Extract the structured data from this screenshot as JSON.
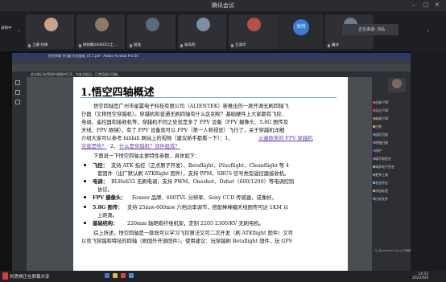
{
  "meeting": {
    "title": "腾讯会议",
    "local_user": "录制中"
  },
  "participants": [
    {
      "name": "土豪·孙妍",
      "avatar_color": "#c9a28a"
    },
    {
      "name": "杨帅鹏2006051土...",
      "avatar_color": "#8b7a66"
    },
    {
      "name": "鼓渔",
      "avatar_color": "#5a6b7a"
    },
    {
      "name": "骑岛院",
      "avatar_color": "#7a8fa3"
    },
    {
      "name": "王滨玲",
      "avatar_color": "#b8504a"
    },
    {
      "name": "冀冰",
      "avatar_color": "#6a7c8e"
    }
  ],
  "presenter": {
    "avatar_text": "洪玲",
    "speaking": "正在讲话: 刘弘"
  },
  "pdf": {
    "window_title": "悟空四轴飞行器-开发指南_V1.1.pdf - Adobe Acrobat Pro DC",
    "notice": "此文档已在受保护视图中打开。为安全起见，已禁用部分功能。",
    "heading": "1.悟空四轴概述",
    "paragraphs": [
      "悟空四轴是广州市星翼电子科技有限公司（ALIENTEK）新推出的一款开源无刷四轴飞",
      "行器（又称悟空穿越机）。穿越机和普通无刷四轴有什么区别呢？基础硬件上大家都有飞控、",
      "电调、遥控器和接收机等，穿越机不同之处就是多了 FPV 设备（FPV 摄像头、5.8G 图传及",
      "天线、FPV 眼镜），有了 FPV 设备就可以 FPV（第一人称视觉）飞行了，关于穿越机详细",
      "介绍大家可以参考 bilibili 网站上的视频（建议新手都看一下）：1、",
      "究竟是啥？",
      "2、",
      "下面说一下悟空四轴主要特性参数，具体如下："
    ],
    "links": [
      "火遍欧美的 FPV 穿越机",
      "什么是穿越机？部件组成？"
    ],
    "bullets": [
      {
        "label": "飞控：",
        "text": "支持 ATK 指控（正点原子开发）、Betaflight、iNavflight、Cleanflight 等 4"
      },
      {
        "label": "",
        "text": "套固件（出厂默认刷 ATKflight 固件），支持 PPM、SBUS 信号类型遥控器接收机。"
      },
      {
        "label": "电调：",
        "text": "BLHeli32 无刷电调，支持 PWM、Oneshot、Dshot（600/1200）等电调控制"
      },
      {
        "label": "",
        "text": "协议。"
      },
      {
        "label": "FPV 摄像头：",
        "text": "Foxeer 品牌、600TVL 分辨率、Sony CCD 传感器，成像好。"
      },
      {
        "label": "5.8G 图传：",
        "text": "支持 25mw-600mw 六档功率调节，搭配棒棒糖天线图传可达 1KM 以"
      },
      {
        "label": "",
        "text": "上距离。"
      },
      {
        "label": "基础结构：",
        "text": "220mm 轴距碳纤维机架，定制 2205 2300/KV 无刷电机。"
      }
    ],
    "closing": [
      "综上所述，悟空四轴是一款既可以学习飞控算法又可二次开发（刷 ATKflight 固件）又可",
      "以竞飞穿越和特技的四轴（刷国外开源固件）。使用建议：玩穿越刷 Betaflight 固件，玩 GPS"
    ]
  },
  "acrobat_panel": {
    "items": [
      "创建 PDF",
      "导出 PDF",
      "编辑 PDF",
      "注释",
      "组织页面",
      "增强扫描",
      "保护",
      "填写和签名",
      "请求电子签名",
      "更多工具",
      "发送评论",
      "添加标签",
      "比较文件"
    ],
    "item_colors": [
      "#d94a3d",
      "#d94a3d",
      "#e55a3a",
      "#e8b43a",
      "#3d8ad9",
      "#9a4ad9",
      "#4a5fd9",
      "#b04ad9",
      "#4ad97a",
      "#888888",
      "#3dd9c1",
      "#d9a23d",
      "#4a8ad9"
    ],
    "footer": "以 Document Cloud 存储和共享文件"
  },
  "taskbar": {
    "share_label": "刘思祺正在屏幕共享",
    "time": "14:52",
    "date": "2022/6/6"
  }
}
